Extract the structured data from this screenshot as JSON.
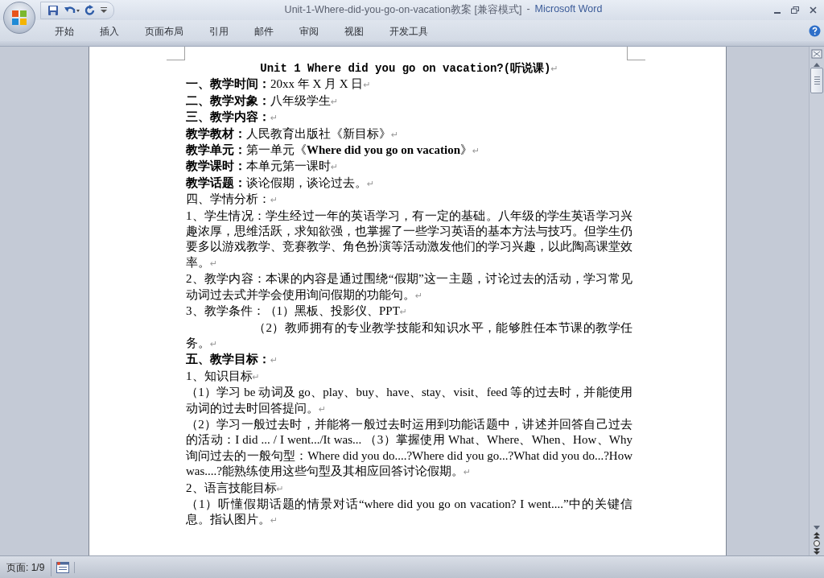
{
  "window": {
    "title": "Unit-1-Where-did-you-go-on-vacation教案 [兼容模式]",
    "separator": "-",
    "app": "Microsoft Word"
  },
  "tabs": [
    {
      "label": "开始",
      "selected": false
    },
    {
      "label": "插入",
      "selected": false
    },
    {
      "label": "页面布局",
      "selected": false
    },
    {
      "label": "引用",
      "selected": false
    },
    {
      "label": "邮件",
      "selected": false
    },
    {
      "label": "审阅",
      "selected": false
    },
    {
      "label": "视图",
      "selected": false
    },
    {
      "label": "开发工具",
      "selected": false
    }
  ],
  "document": {
    "end_mark": "↵",
    "paragraphs": [
      {
        "kind": "title",
        "text": "Unit 1 Where did you go on vacation?(听说课)"
      },
      {
        "kind": "labeled",
        "label": "一、教学时间：",
        "text": "20xx 年 X 月 X 日"
      },
      {
        "kind": "labeled",
        "label": "二、教学对象：",
        "text": "八年级学生"
      },
      {
        "kind": "heading",
        "text": "三、教学内容："
      },
      {
        "kind": "labeled",
        "label": "教学教材：",
        "text": "人民教育出版社《新目标》"
      },
      {
        "kind": "labeled",
        "label": "教学单元：",
        "text": "第一单元《**Where did you go on vacation**》"
      },
      {
        "kind": "labeled",
        "label": "教学课时：",
        "text": "本单元第一课时"
      },
      {
        "kind": "labeled",
        "label": "教学话题：",
        "text": "谈论假期，谈论过去。"
      },
      {
        "kind": "plain",
        "text": "四、学情分析："
      },
      {
        "kind": "plain",
        "text": "1、学生情况：学生经过一年的英语学习，有一定的基础。八年级的学生英语学习兴趣浓厚，思维活跃，求知欲强，也掌握了一些学习英语的基本方法与技巧。但学生仍要多以游戏教学、竞赛教学、角色扮演等活动激发他们的学习兴趣，以此陶高课堂效率。"
      },
      {
        "kind": "plain",
        "text": "2、教学内容：本课的内容是通过围绕“假期”这一主题，讨论过去的活动，学习常见动词过去式并学会使用询问假期的功能句。"
      },
      {
        "kind": "plain",
        "text": "3、教学条件：（1）黑板、投影仪、PPT"
      },
      {
        "kind": "indented",
        "text": "（2）教师拥有的专业教学技能和知识水平，能够胜任本节课的教学任务。"
      },
      {
        "kind": "heading",
        "text": "五、教学目标："
      },
      {
        "kind": "plain",
        "text": "1、知识目标"
      },
      {
        "kind": "plain",
        "text": "（1）学习 be 动词及 go、play、buy、have、stay、visit、feed 等的过去时，并能使用动词的过去时回答提问。"
      },
      {
        "kind": "plain",
        "text": "（2）学习一般过去时，并能将一般过去时运用到功能话题中，讲述并回答自己过去的活动：I did ... / I went.../It was... （3）掌握使用 What、Where、When、How、Why 询问过去的一般句型：Where did you do....?Where did you go...?What did you do...?How was....?能熟练使用这些句型及其相应回答讨论假期。"
      },
      {
        "kind": "plain",
        "text": "2、语言技能目标"
      },
      {
        "kind": "plain",
        "text": "（1）听懂假期话题的情景对话“where did you go on vacation? I went....”中的关键信息。指认图片。"
      }
    ]
  },
  "status_bar": {
    "page": "页面: 1/9"
  }
}
